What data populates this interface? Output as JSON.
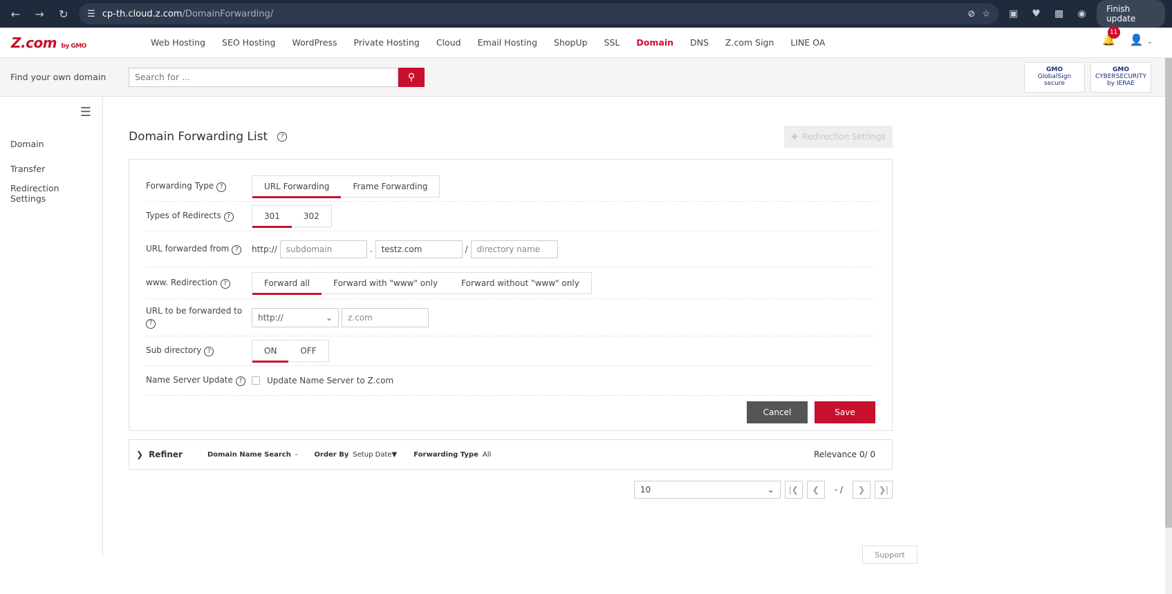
{
  "browser": {
    "host": "cp-th.cloud.z.com",
    "path": "/DomainForwarding/",
    "finish_update": "Finish update"
  },
  "topnav": {
    "logo": "Z.com",
    "logo_sub": "by GMO",
    "items": [
      "Web Hosting",
      "SEO Hosting",
      "WordPress",
      "Private Hosting",
      "Cloud",
      "Email Hosting",
      "ShopUp",
      "SSL",
      "Domain",
      "DNS",
      "Z.com Sign",
      "LINE OA"
    ],
    "active": "Domain",
    "notification_count": "11"
  },
  "search": {
    "label": "Find your own domain",
    "placeholder": "Search for ..."
  },
  "seals": {
    "globalsign": [
      "GMO",
      "GlobalSign",
      "secure"
    ],
    "ierae": [
      "GMO",
      "CYBERSECURITY",
      "by IERAE"
    ]
  },
  "sidebar": {
    "items": [
      "Domain",
      "Transfer",
      "Redirection Settings"
    ]
  },
  "main": {
    "title": "Domain Forwarding List",
    "redirection_button": "Redirection Settings",
    "form": {
      "forwarding_type": {
        "label": "Forwarding Type",
        "options": [
          "URL Forwarding",
          "Frame Forwarding"
        ],
        "selected": "URL Forwarding"
      },
      "redirect_type": {
        "label": "Types of Redirects",
        "options": [
          "301",
          "302"
        ],
        "selected": "301"
      },
      "url_from": {
        "label": "URL forwarded from",
        "prefix": "http://",
        "subdomain_placeholder": "subdomain",
        "domain_value": "testz.com",
        "directory_placeholder": "directory name"
      },
      "www": {
        "label": "www. Redirection",
        "options": [
          "Forward all",
          "Forward with \"www\" only",
          "Forward without \"www\" only"
        ],
        "selected": "Forward all"
      },
      "url_to": {
        "label": "URL to be forwarded to",
        "protocol": "http://",
        "value_placeholder": "z.com"
      },
      "subdir": {
        "label": "Sub directory",
        "options": [
          "ON",
          "OFF"
        ],
        "selected": "ON"
      },
      "nameserver": {
        "label": "Name Server Update",
        "checkbox_label": "Update Name Server to Z.com"
      },
      "cancel": "Cancel",
      "save": "Save"
    },
    "refiner": {
      "title": "Refiner",
      "domain_search_key": "Domain Name Search",
      "domain_search_val": "-",
      "order_key": "Order By",
      "order_val": "Setup Date▼",
      "type_key": "Forwarding Type",
      "type_val": "All",
      "relevance": "Relevance 0/ 0"
    },
    "pager": {
      "per_page": "10",
      "page_text": "- /"
    },
    "support": "Support"
  }
}
